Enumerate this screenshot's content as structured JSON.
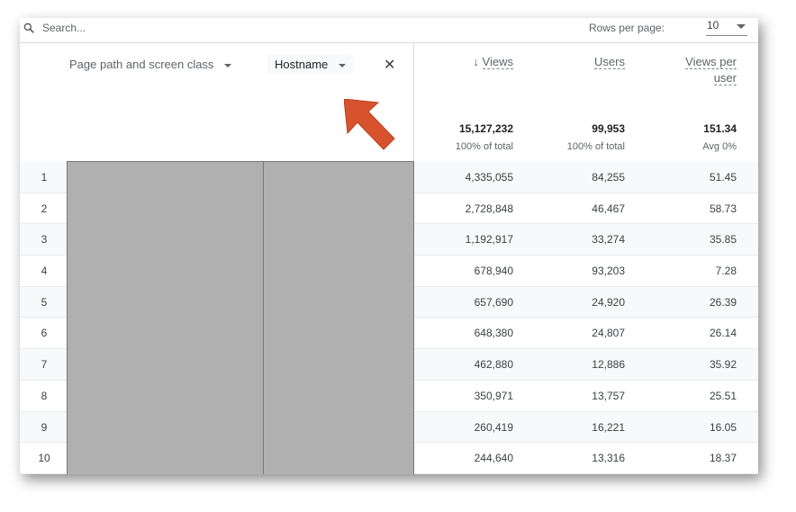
{
  "search": {
    "placeholder": "Search...",
    "icon": "search-icon"
  },
  "pagination": {
    "rows_per_page_label": "Rows per page:",
    "rows_per_page_value": "10"
  },
  "dimensions": [
    {
      "label": "Page path and screen class"
    },
    {
      "label": "Hostname"
    }
  ],
  "metrics": [
    {
      "label": "Views",
      "sorted": "descending",
      "total": "15,127,232",
      "sub": "100% of total"
    },
    {
      "label": "Users",
      "total": "99,953",
      "sub": "100% of total"
    },
    {
      "label": "Views per user",
      "total": "151.34",
      "sub": "Avg 0%"
    }
  ],
  "rows": [
    {
      "i": "1",
      "views": "4,335,055",
      "users": "84,255",
      "vpu": "51.45"
    },
    {
      "i": "2",
      "views": "2,728,848",
      "users": "46,467",
      "vpu": "58.73"
    },
    {
      "i": "3",
      "views": "1,192,917",
      "users": "33,274",
      "vpu": "35.85"
    },
    {
      "i": "4",
      "views": "678,940",
      "users": "93,203",
      "vpu": "7.28"
    },
    {
      "i": "5",
      "views": "657,690",
      "users": "24,920",
      "vpu": "26.39"
    },
    {
      "i": "6",
      "views": "648,380",
      "users": "24,807",
      "vpu": "26.14"
    },
    {
      "i": "7",
      "views": "462,880",
      "users": "12,886",
      "vpu": "35.92"
    },
    {
      "i": "8",
      "views": "350,971",
      "users": "13,757",
      "vpu": "25.51"
    },
    {
      "i": "9",
      "views": "260,419",
      "users": "16,221",
      "vpu": "16.05"
    },
    {
      "i": "10",
      "views": "244,640",
      "users": "13,316",
      "vpu": "18.37"
    }
  ],
  "colors": {
    "annotation_arrow": "#d9522e",
    "redaction": "#b0b0b0"
  }
}
